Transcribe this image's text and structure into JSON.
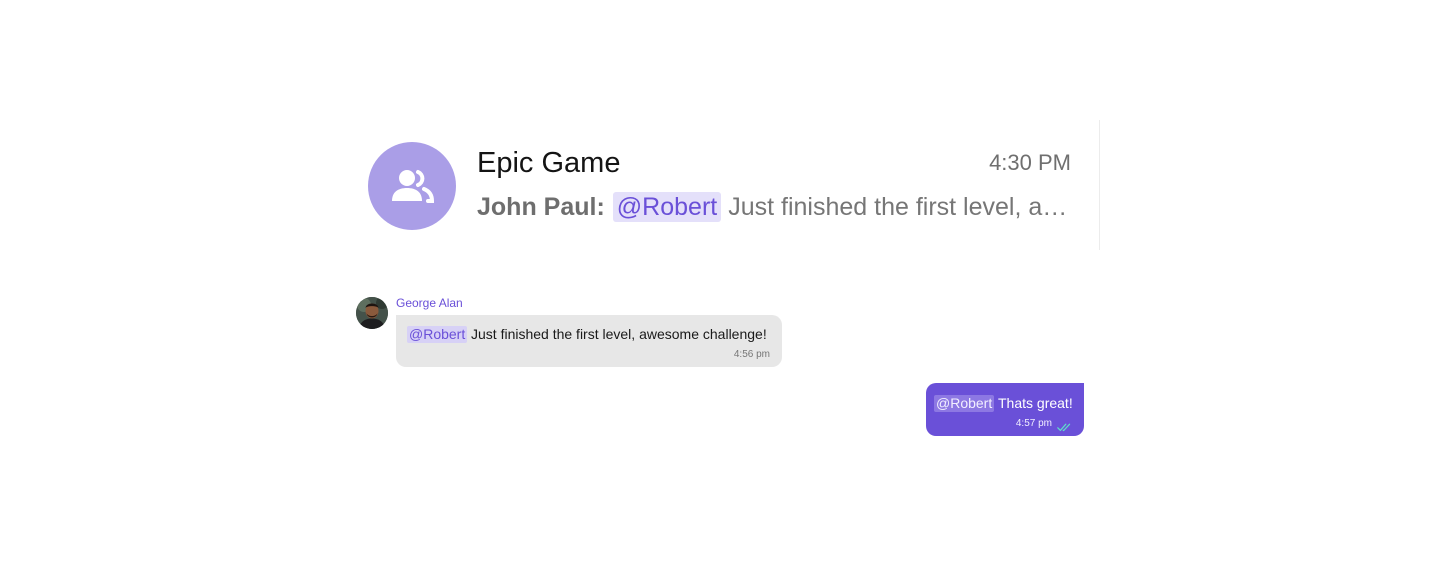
{
  "conversation": {
    "title": "Epic Game",
    "time": "4:30 PM",
    "sender": "John Paul:",
    "mention": "@Robert",
    "preview_text": "Just finished the first level, awesome challenge!",
    "avatar_icon": "group-icon",
    "avatar_color": "#aa9ee7"
  },
  "messages": [
    {
      "direction": "incoming",
      "sender": "George Alan",
      "mention": "@Robert",
      "text": "Just finished the first level, awesome challenge!",
      "time": "4:56 pm",
      "avatar_icon": "user-photo"
    },
    {
      "direction": "outgoing",
      "mention": "@Robert",
      "text": "Thats great!",
      "time": "4:57 pm",
      "status_icon": "double-check-icon"
    }
  ],
  "colors": {
    "accent": "#6a50d8",
    "incoming_bubble": "#e7e7e7",
    "mention_bg": "#e4e0fa",
    "read_tick": "#5ee0c8"
  }
}
